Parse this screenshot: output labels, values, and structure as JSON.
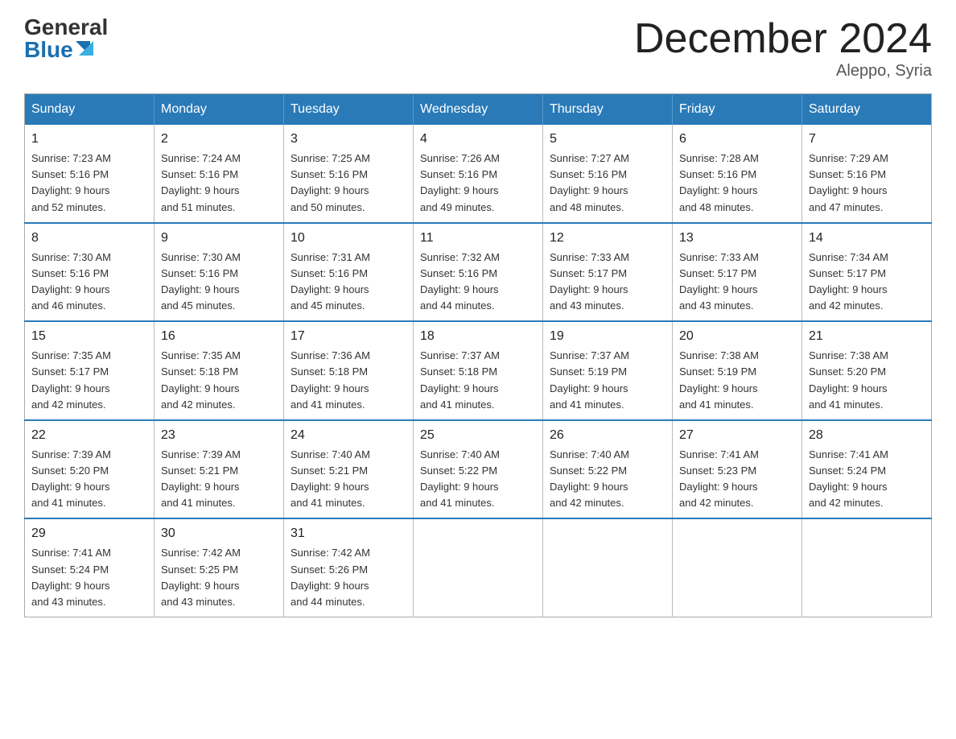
{
  "logo": {
    "general": "General",
    "blue": "Blue"
  },
  "title": "December 2024",
  "subtitle": "Aleppo, Syria",
  "days_of_week": [
    "Sunday",
    "Monday",
    "Tuesday",
    "Wednesday",
    "Thursday",
    "Friday",
    "Saturday"
  ],
  "weeks": [
    [
      {
        "day": "1",
        "sunrise": "7:23 AM",
        "sunset": "5:16 PM",
        "daylight": "9 hours and 52 minutes."
      },
      {
        "day": "2",
        "sunrise": "7:24 AM",
        "sunset": "5:16 PM",
        "daylight": "9 hours and 51 minutes."
      },
      {
        "day": "3",
        "sunrise": "7:25 AM",
        "sunset": "5:16 PM",
        "daylight": "9 hours and 50 minutes."
      },
      {
        "day": "4",
        "sunrise": "7:26 AM",
        "sunset": "5:16 PM",
        "daylight": "9 hours and 49 minutes."
      },
      {
        "day": "5",
        "sunrise": "7:27 AM",
        "sunset": "5:16 PM",
        "daylight": "9 hours and 48 minutes."
      },
      {
        "day": "6",
        "sunrise": "7:28 AM",
        "sunset": "5:16 PM",
        "daylight": "9 hours and 48 minutes."
      },
      {
        "day": "7",
        "sunrise": "7:29 AM",
        "sunset": "5:16 PM",
        "daylight": "9 hours and 47 minutes."
      }
    ],
    [
      {
        "day": "8",
        "sunrise": "7:30 AM",
        "sunset": "5:16 PM",
        "daylight": "9 hours and 46 minutes."
      },
      {
        "day": "9",
        "sunrise": "7:30 AM",
        "sunset": "5:16 PM",
        "daylight": "9 hours and 45 minutes."
      },
      {
        "day": "10",
        "sunrise": "7:31 AM",
        "sunset": "5:16 PM",
        "daylight": "9 hours and 45 minutes."
      },
      {
        "day": "11",
        "sunrise": "7:32 AM",
        "sunset": "5:16 PM",
        "daylight": "9 hours and 44 minutes."
      },
      {
        "day": "12",
        "sunrise": "7:33 AM",
        "sunset": "5:17 PM",
        "daylight": "9 hours and 43 minutes."
      },
      {
        "day": "13",
        "sunrise": "7:33 AM",
        "sunset": "5:17 PM",
        "daylight": "9 hours and 43 minutes."
      },
      {
        "day": "14",
        "sunrise": "7:34 AM",
        "sunset": "5:17 PM",
        "daylight": "9 hours and 42 minutes."
      }
    ],
    [
      {
        "day": "15",
        "sunrise": "7:35 AM",
        "sunset": "5:17 PM",
        "daylight": "9 hours and 42 minutes."
      },
      {
        "day": "16",
        "sunrise": "7:35 AM",
        "sunset": "5:18 PM",
        "daylight": "9 hours and 42 minutes."
      },
      {
        "day": "17",
        "sunrise": "7:36 AM",
        "sunset": "5:18 PM",
        "daylight": "9 hours and 41 minutes."
      },
      {
        "day": "18",
        "sunrise": "7:37 AM",
        "sunset": "5:18 PM",
        "daylight": "9 hours and 41 minutes."
      },
      {
        "day": "19",
        "sunrise": "7:37 AM",
        "sunset": "5:19 PM",
        "daylight": "9 hours and 41 minutes."
      },
      {
        "day": "20",
        "sunrise": "7:38 AM",
        "sunset": "5:19 PM",
        "daylight": "9 hours and 41 minutes."
      },
      {
        "day": "21",
        "sunrise": "7:38 AM",
        "sunset": "5:20 PM",
        "daylight": "9 hours and 41 minutes."
      }
    ],
    [
      {
        "day": "22",
        "sunrise": "7:39 AM",
        "sunset": "5:20 PM",
        "daylight": "9 hours and 41 minutes."
      },
      {
        "day": "23",
        "sunrise": "7:39 AM",
        "sunset": "5:21 PM",
        "daylight": "9 hours and 41 minutes."
      },
      {
        "day": "24",
        "sunrise": "7:40 AM",
        "sunset": "5:21 PM",
        "daylight": "9 hours and 41 minutes."
      },
      {
        "day": "25",
        "sunrise": "7:40 AM",
        "sunset": "5:22 PM",
        "daylight": "9 hours and 41 minutes."
      },
      {
        "day": "26",
        "sunrise": "7:40 AM",
        "sunset": "5:22 PM",
        "daylight": "9 hours and 42 minutes."
      },
      {
        "day": "27",
        "sunrise": "7:41 AM",
        "sunset": "5:23 PM",
        "daylight": "9 hours and 42 minutes."
      },
      {
        "day": "28",
        "sunrise": "7:41 AM",
        "sunset": "5:24 PM",
        "daylight": "9 hours and 42 minutes."
      }
    ],
    [
      {
        "day": "29",
        "sunrise": "7:41 AM",
        "sunset": "5:24 PM",
        "daylight": "9 hours and 43 minutes."
      },
      {
        "day": "30",
        "sunrise": "7:42 AM",
        "sunset": "5:25 PM",
        "daylight": "9 hours and 43 minutes."
      },
      {
        "day": "31",
        "sunrise": "7:42 AM",
        "sunset": "5:26 PM",
        "daylight": "9 hours and 44 minutes."
      },
      null,
      null,
      null,
      null
    ]
  ],
  "labels": {
    "sunrise": "Sunrise:",
    "sunset": "Sunset:",
    "daylight": "Daylight:"
  }
}
